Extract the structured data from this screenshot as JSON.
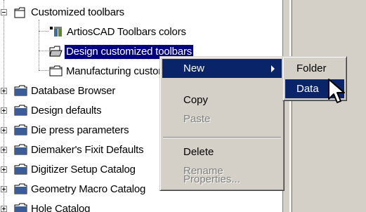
{
  "tree": {
    "items": [
      {
        "label": "Customized toolbars",
        "expander": "minus",
        "icon": "folder-open-icon"
      },
      {
        "label": "ArtiosCAD Toolbars colors",
        "icon": "toolbar-colors-icon"
      },
      {
        "label": "Design customized toolbars",
        "icon": "folder-open-icon",
        "selected": true
      },
      {
        "label": "Manufacturing customized toolbars",
        "icon": "folder-icon"
      },
      {
        "label": "Database Browser",
        "expander": "plus",
        "icon": "catalog-folder-icon"
      },
      {
        "label": "Design defaults",
        "expander": "plus",
        "icon": "catalog-folder-icon"
      },
      {
        "label": "Die press parameters",
        "expander": "plus",
        "icon": "catalog-folder-icon"
      },
      {
        "label": "Diemaker's Fixit Defaults",
        "expander": "plus",
        "icon": "catalog-folder-icon"
      },
      {
        "label": "Digitizer Setup Catalog",
        "expander": "plus",
        "icon": "catalog-folder-icon"
      },
      {
        "label": "Geometry Macro Catalog",
        "expander": "plus",
        "icon": "catalog-folder-icon"
      },
      {
        "label": "Hole Catalog",
        "expander": "plus",
        "icon": "catalog-folder-icon"
      }
    ]
  },
  "context_menu": {
    "items": [
      {
        "label": "New",
        "submenu": true,
        "active": true
      },
      {
        "label": "Copy"
      },
      {
        "label": "Paste",
        "disabled": true
      },
      {
        "label": "Delete"
      },
      {
        "label": "Rename",
        "disabled": true
      },
      {
        "label": "Properties...",
        "disabled": true
      }
    ]
  },
  "submenu": {
    "items": [
      {
        "label": "Folder"
      },
      {
        "label": "Data",
        "active": true
      }
    ]
  },
  "colors": {
    "selection": "#000080",
    "menu_highlight": "#0a246a",
    "menu_background": "#d4d0c8",
    "disabled_text": "#808080"
  }
}
